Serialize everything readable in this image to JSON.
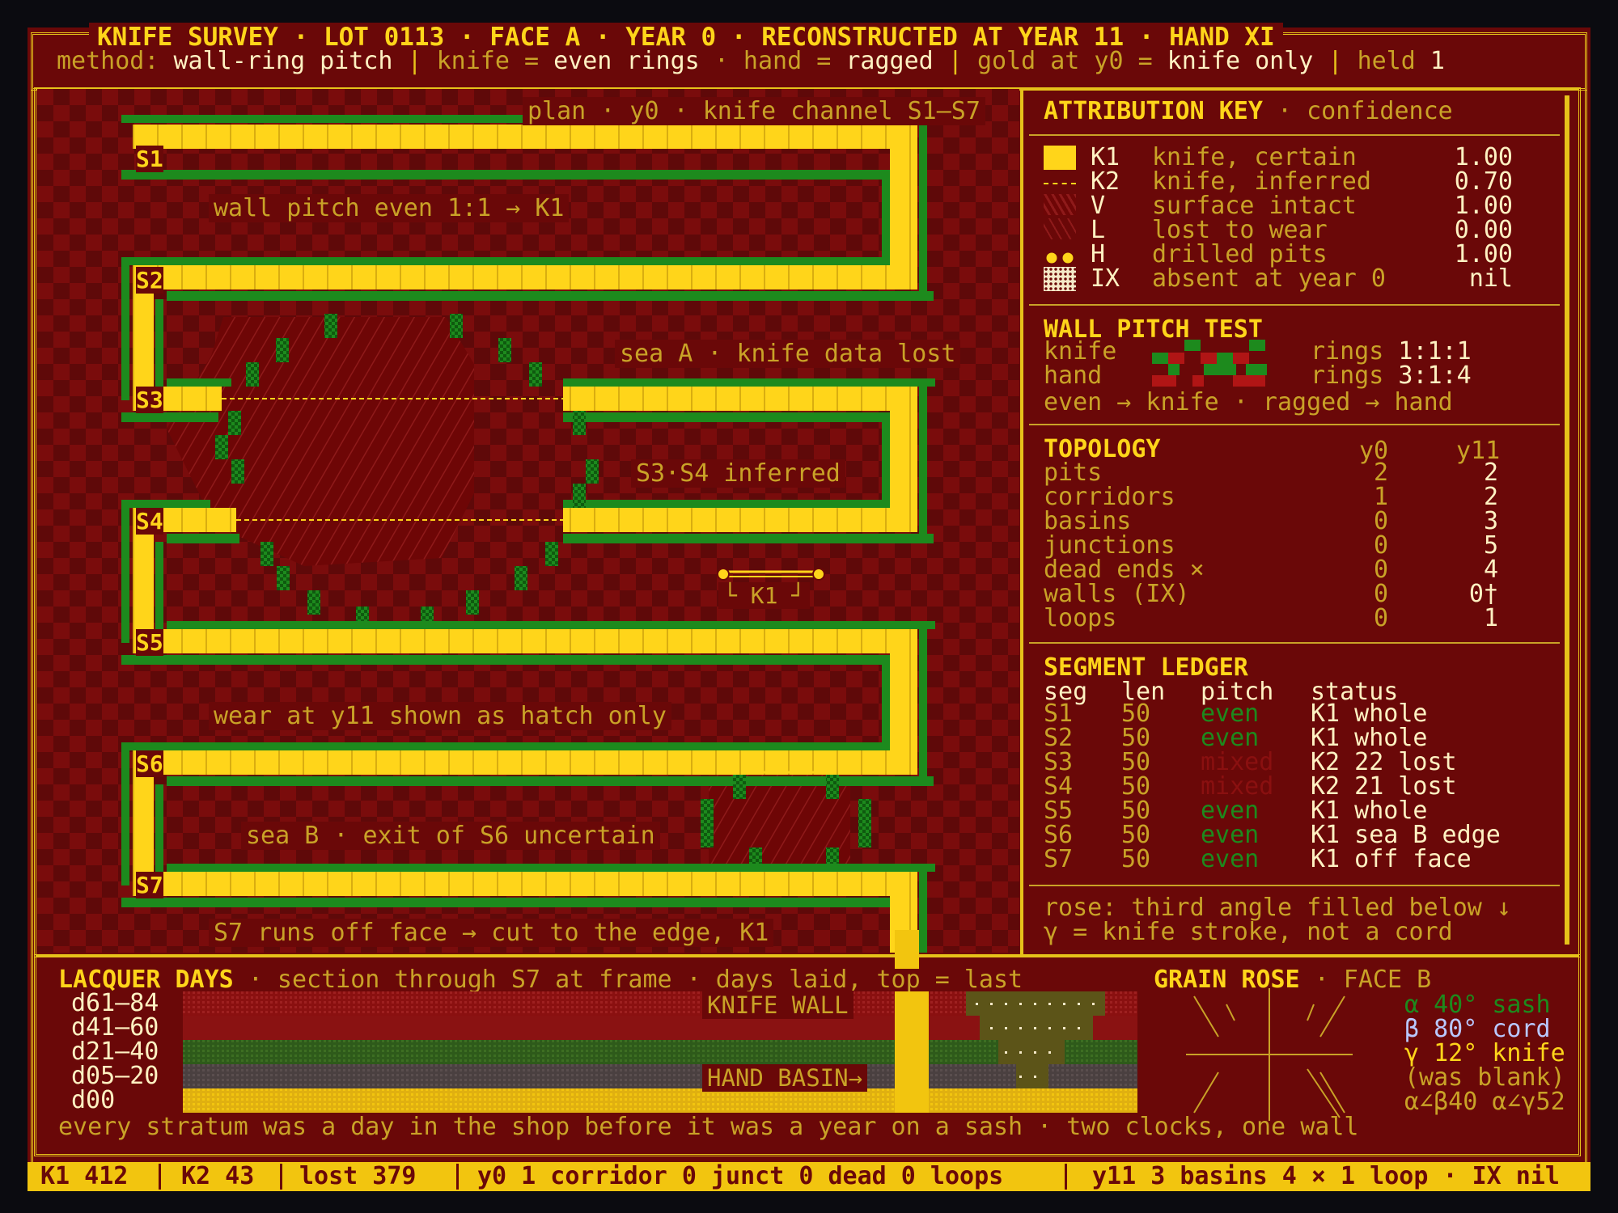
{
  "header": {
    "title": "KNIFE SURVEY · LOT 0113 · FACE A · YEAR 0 · RECONSTRUCTED AT YEAR 11 · HAND XI",
    "method_label": "method:",
    "method_value": "wall-ring pitch",
    "knife_label": "knife =",
    "knife_value": "even rings",
    "hand_label": "· hand =",
    "hand_value": "ragged",
    "gold_label": "gold at y0 =",
    "gold_value": "knife only",
    "held_label": "held",
    "held_value": "1"
  },
  "plan": {
    "caption": "plan · y0 · knife channel S1–S7",
    "segments": [
      "S1",
      "S2",
      "S3",
      "S4",
      "S5",
      "S6",
      "S7"
    ],
    "notes": {
      "n1": "wall pitch even 1:1 → K1",
      "n2": "sea A · knife data lost",
      "n3": "S3·S4 inferred",
      "n4": "K1",
      "n5": "wear at y11 shown as hatch only",
      "n6": "sea B · exit of S6 uncertain",
      "n7": "S7 runs off face → cut to the edge, K1"
    }
  },
  "key": {
    "title": "ATTRIBUTION KEY",
    "subtitle": "· confidence",
    "rows": [
      {
        "code": "K1",
        "desc": "knife, certain",
        "conf": "1.00"
      },
      {
        "code": "K2",
        "desc": "knife, inferred",
        "conf": "0.70"
      },
      {
        "code": "V",
        "desc": "surface intact",
        "conf": "1.00"
      },
      {
        "code": "L",
        "desc": "lost to wear",
        "conf": "0.00"
      },
      {
        "code": "H",
        "desc": "drilled pits",
        "conf": "1.00"
      },
      {
        "code": "IX",
        "desc": "absent at year 0",
        "conf": "nil"
      }
    ]
  },
  "pitch": {
    "title": "WALL PITCH TEST",
    "knife_label": "knife",
    "hand_label": "hand",
    "knife_rings_label": "rings",
    "knife_rings": "1:1:1",
    "hand_rings_label": "rings",
    "hand_rings": "3:1:4",
    "rule": "even → knife · ragged → hand"
  },
  "topology": {
    "title": "TOPOLOGY",
    "col_y0": "y0",
    "col_y11": "y11",
    "rows": [
      {
        "name": "pits",
        "y0": "2",
        "y11": "2"
      },
      {
        "name": "corridors",
        "y0": "1",
        "y11": "2"
      },
      {
        "name": "basins",
        "y0": "0",
        "y11": "3"
      },
      {
        "name": "junctions",
        "y0": "0",
        "y11": "5"
      },
      {
        "name": "dead ends ×",
        "y0": "0",
        "y11": "4"
      },
      {
        "name": "walls (IX)",
        "y0": "0",
        "y11": "0†"
      },
      {
        "name": "loops",
        "y0": "0",
        "y11": "1"
      }
    ]
  },
  "ledger": {
    "title": "SEGMENT LEDGER",
    "headers": {
      "seg": "seg",
      "len": "len",
      "pitch": "pitch",
      "status": "status"
    },
    "rows": [
      {
        "seg": "S1",
        "len": "50",
        "pitch": "even",
        "status": "K1 whole"
      },
      {
        "seg": "S2",
        "len": "50",
        "pitch": "even",
        "status": "K1 whole"
      },
      {
        "seg": "S3",
        "len": "50",
        "pitch": "mixed",
        "status": "K2 22 lost"
      },
      {
        "seg": "S4",
        "len": "50",
        "pitch": "mixed",
        "status": "K2 21 lost"
      },
      {
        "seg": "S5",
        "len": "50",
        "pitch": "even",
        "status": "K1 whole"
      },
      {
        "seg": "S6",
        "len": "50",
        "pitch": "even",
        "status": "K1 sea B edge"
      },
      {
        "seg": "S7",
        "len": "50",
        "pitch": "even",
        "status": "K1 off face"
      }
    ]
  },
  "rose_note": {
    "line1": "rose: third angle filled below ↓",
    "line2": "γ = knife stroke, not a cord"
  },
  "lacquer": {
    "title": "LACQUER DAYS",
    "subtitle": "· section through S7 at frame · days laid, top = last",
    "strata": [
      "d61–84",
      "d41–60",
      "d21–40",
      "d05–20",
      "d00"
    ],
    "knife_wall": "KNIFE WALL",
    "hand_basin": "HAND BASIN→",
    "footnote": "every stratum was a day in the shop before it was a year on a sash · two clocks, one wall"
  },
  "rose": {
    "title": "GRAIN ROSE",
    "subtitle": "· FACE B",
    "alpha": "α 40° sash",
    "beta": "β 80° cord",
    "gamma": "γ 12° knife",
    "gamma_note": "(was blank)",
    "angles": "α∠β40 α∠γ52"
  },
  "status": {
    "k1": "K1 412",
    "k2": "K2 43",
    "lost": "lost 379",
    "y0": "y0 1 corridor 0 junct 0 dead 0 loops",
    "y11": "y11 3 basins 4 × 1 loop · IX nil"
  },
  "colors": {
    "gold": "#ffd51a",
    "maroon": "#6a0808",
    "green": "#1d8a1d",
    "text": "#c9a227",
    "cord": "#b9c8ff"
  }
}
